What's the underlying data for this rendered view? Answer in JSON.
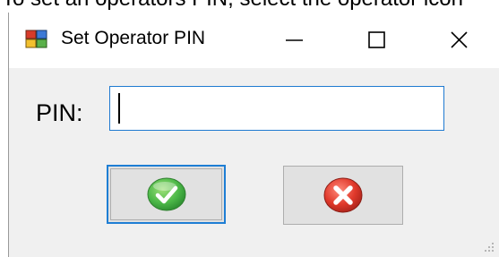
{
  "background_caption": "To set an operators PIN, select the operator icon",
  "dialog": {
    "title": "Set Operator PIN",
    "minimize_glyph": "—",
    "maximize_glyph": "☐",
    "close_glyph": "✕"
  },
  "form": {
    "pin_label": "PIN:",
    "pin_value": ""
  },
  "buttons": {
    "ok_icon": "green-checkmark-icon",
    "cancel_icon": "red-x-icon"
  },
  "colors": {
    "focus_border": "#1e7ed4",
    "ok_green": "#4cb848",
    "cancel_red": "#e0392b",
    "dialog_bg": "#f0f0f0"
  }
}
